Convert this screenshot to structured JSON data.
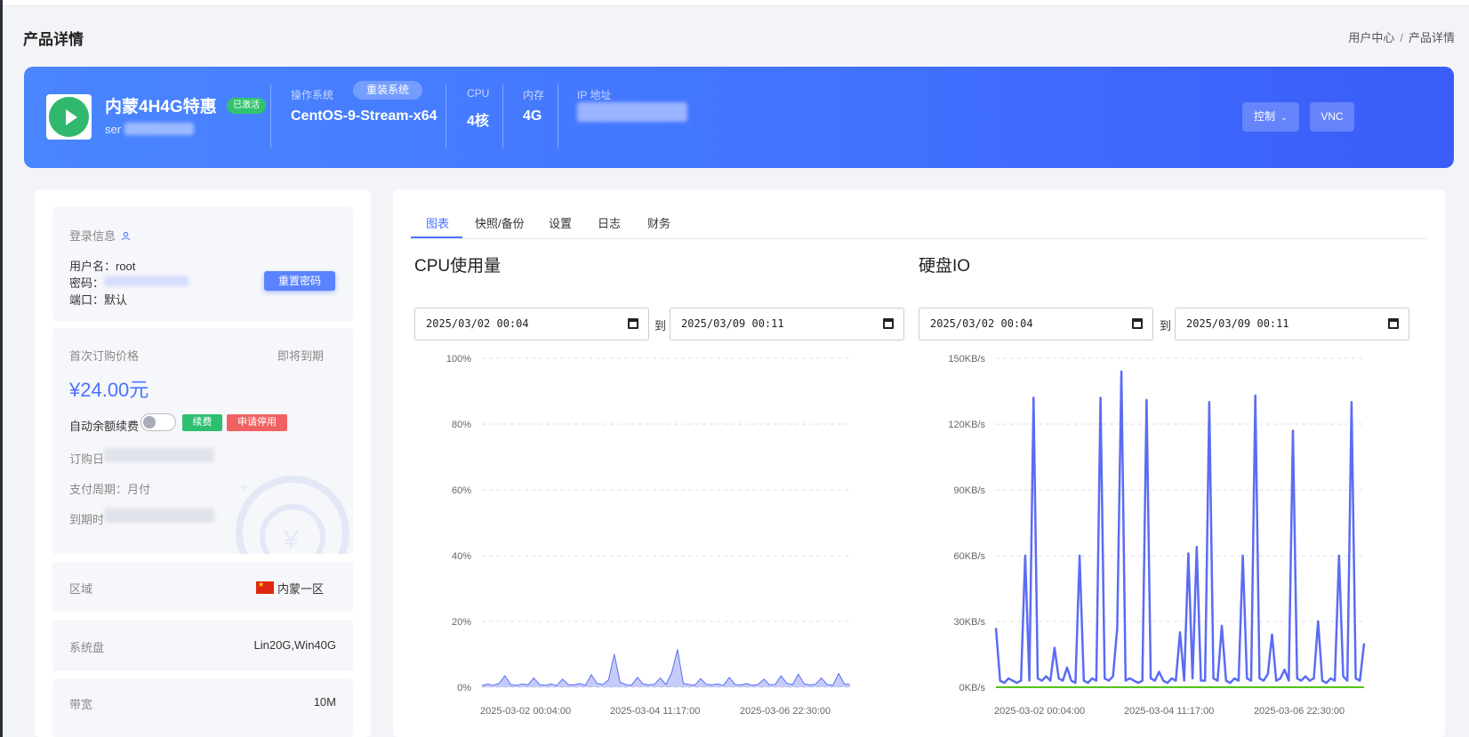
{
  "page": {
    "title": "产品详情"
  },
  "breadcrumb": {
    "home": "用户中心",
    "separator": "/",
    "current": "产品详情"
  },
  "banner": {
    "product_name": "内蒙4H4G特惠",
    "status_badge": "已激活",
    "server_name_visible": "ser",
    "os_label": "操作系统",
    "reinstall_label": "重装系统",
    "os_value": "CentOS-9-Stream-x64",
    "cpu_label": "CPU",
    "cpu_value": "4核",
    "mem_label": "内存",
    "mem_value": "4G",
    "ip_label": "IP 地址",
    "control_label": "控制",
    "vnc_label": "VNC",
    "play_icon": "play-icon",
    "colors": {
      "start": "#4a86ff",
      "end": "#3a5cf8",
      "badge": "#31c36d"
    }
  },
  "login": {
    "heading": "登录信息",
    "username": "用户名：root",
    "password_label": "密码：",
    "port": "端口：默认",
    "reset_password_label": "重置密码"
  },
  "billing": {
    "first_price_label": "首次订购价格",
    "expiry_status": "即将到期",
    "price": "¥24.00元",
    "auto_renew_label": "自动余额续费",
    "auto_renew_enabled": false,
    "renew_label": "续费",
    "suspend_label": "申请停用",
    "order_date_label": "订购日",
    "billing_cycle": "支付周期：月付",
    "due_date_label": "到期时"
  },
  "info": {
    "region_label": "区域",
    "region_value": "内蒙一区",
    "disk_label": "系统盘",
    "disk_value": "Lin20G,Win40G",
    "bandwidth_label": "带宽",
    "bandwidth_value": "10M"
  },
  "tabs": [
    {
      "label": "图表",
      "active": true
    },
    {
      "label": "快照/备份",
      "active": false
    },
    {
      "label": "设置",
      "active": false
    },
    {
      "label": "日志",
      "active": false
    },
    {
      "label": "财务",
      "active": false
    }
  ],
  "cpu_panel": {
    "title": "CPU使用量",
    "start": "2025/03/02 00:04",
    "to_label": "到",
    "end": "2025/03/09 00:11"
  },
  "disk_panel": {
    "title": "硬盘IO",
    "start": "2025/03/02 00:04",
    "to_label": "到",
    "end": "2025/03/09 00:11"
  },
  "chart_data": [
    {
      "type": "area",
      "title": "CPU使用量",
      "ylim": [
        0,
        100
      ],
      "y_ticks": [
        "0%",
        "20%",
        "40%",
        "60%",
        "80%",
        "100%"
      ],
      "x_ticks": [
        "2025-03-02 00:04:00",
        "2025-03-04 11:17:00",
        "2025-03-06 22:30:00"
      ],
      "grid": true,
      "series": [
        {
          "color": "#5b6cf2",
          "values": [
            0.5,
            1,
            0.6,
            1.2,
            3.5,
            0.8,
            0.6,
            1,
            0.7,
            2.8,
            0.8,
            0.6,
            1,
            0.5,
            2.5,
            0.8,
            0.7,
            1.1,
            0.6,
            3.8,
            1.2,
            0.8,
            2.2,
            10,
            1.5,
            0.8,
            0.6,
            3,
            1,
            0.7,
            0.9,
            2.8,
            0.8,
            4.5,
            11.5,
            1.2,
            0.8,
            0.6,
            2.6,
            0.9,
            0.7,
            1,
            0.6,
            3,
            0.8,
            0.7,
            1.1,
            0.6,
            0.8,
            2.5,
            0.7,
            0.9,
            3.5,
            1.2,
            0.8,
            4,
            1,
            0.7,
            0.9,
            2.8,
            0.8,
            0.6,
            4.2,
            1,
            0.8
          ]
        }
      ]
    },
    {
      "type": "line",
      "title": "硬盘IO",
      "ylim": [
        0,
        150
      ],
      "y_ticks": [
        "0KB/s",
        "30KB/s",
        "60KB/s",
        "90KB/s",
        "120KB/s",
        "150KB/s"
      ],
      "x_ticks": [
        "2025-03-02 00:04:00",
        "2025-03-04 11:17:00",
        "2025-03-06 22:30:00"
      ],
      "grid": true,
      "series": [
        {
          "color": "#5b6cf2",
          "values": [
            27,
            3,
            2,
            4,
            3,
            2,
            3,
            60,
            3,
            132,
            4,
            3,
            5,
            3,
            18,
            4,
            3,
            9,
            3,
            2,
            60,
            3,
            2,
            4,
            3,
            132,
            4,
            3,
            5,
            27,
            144,
            3,
            4,
            3,
            2,
            3,
            131,
            4,
            3,
            7,
            3,
            2,
            4,
            3,
            25,
            3,
            61,
            4,
            64,
            3,
            3,
            130,
            4,
            3,
            28,
            3,
            2,
            4,
            3,
            60,
            4,
            3,
            133,
            4,
            3,
            6,
            24,
            3,
            4,
            8,
            3,
            117,
            4,
            3,
            5,
            3,
            4,
            30,
            3,
            2,
            4,
            3,
            60,
            5,
            3,
            130,
            4,
            3,
            20
          ]
        },
        {
          "color": "#52c41a",
          "values": [
            0,
            0,
            0,
            0,
            0,
            0,
            0,
            0,
            0,
            0,
            0,
            0,
            0,
            0,
            0,
            0,
            0,
            0,
            0,
            0,
            0,
            0,
            0,
            0,
            0,
            0,
            0,
            0,
            0,
            0,
            0,
            0,
            0,
            0,
            0,
            0,
            0,
            0,
            0,
            0,
            0,
            0,
            0,
            0,
            0,
            0,
            0,
            0,
            0,
            0,
            0,
            0,
            0,
            0,
            0,
            0,
            0,
            0,
            0,
            0,
            0,
            0,
            0,
            0,
            0,
            0,
            0,
            0,
            0,
            0,
            0,
            0,
            0,
            0,
            0,
            0,
            0,
            0,
            0,
            0,
            0,
            0,
            0,
            0,
            0,
            0,
            0,
            0,
            0
          ]
        }
      ]
    }
  ]
}
